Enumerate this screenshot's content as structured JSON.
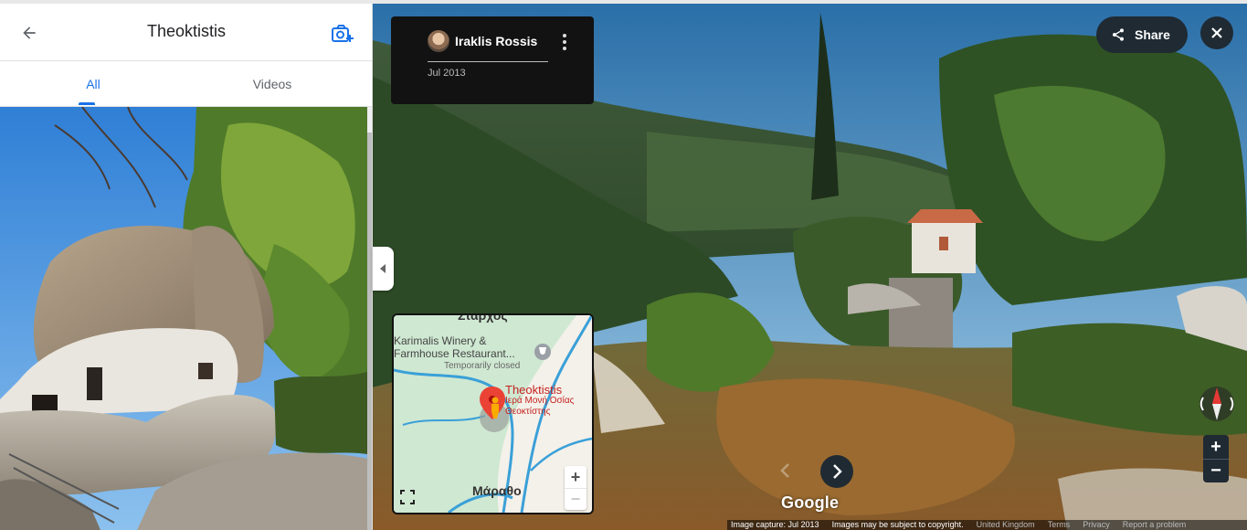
{
  "panel": {
    "title": "Theoktistis",
    "tabs": [
      {
        "label": "All",
        "active": true
      },
      {
        "label": "Videos",
        "active": false
      }
    ],
    "icons": {
      "back": "arrow-back-icon",
      "add_photo": "add-photo-icon"
    }
  },
  "contributor": {
    "name": "Iraklis Rossis",
    "date": "Jul 2013"
  },
  "share": {
    "label": "Share"
  },
  "minimap": {
    "top_label": "Σταρχός",
    "poi_name": "Karimalis Winery & Farmhouse Restaurant...",
    "poi_status": "Temporarily closed",
    "place_name": "Theoktistis",
    "place_subtitle": "Ιερά Μονή Οσίας Θεοκτίστης",
    "town": "Μάραθο",
    "zoom_in": "+",
    "zoom_out": "−"
  },
  "streetview": {
    "zoom_in": "+",
    "zoom_out": "−",
    "logo": "Google"
  },
  "footer": {
    "capture": "Image capture: Jul 2013",
    "copyright": "Images may be subject to copyright.",
    "region": "United Kingdom",
    "terms": "Terms",
    "privacy": "Privacy",
    "report": "Report a problem"
  },
  "colors": {
    "accent": "#1a73e8",
    "place_red": "#c5221f",
    "control_bg": "#1f2a33"
  }
}
